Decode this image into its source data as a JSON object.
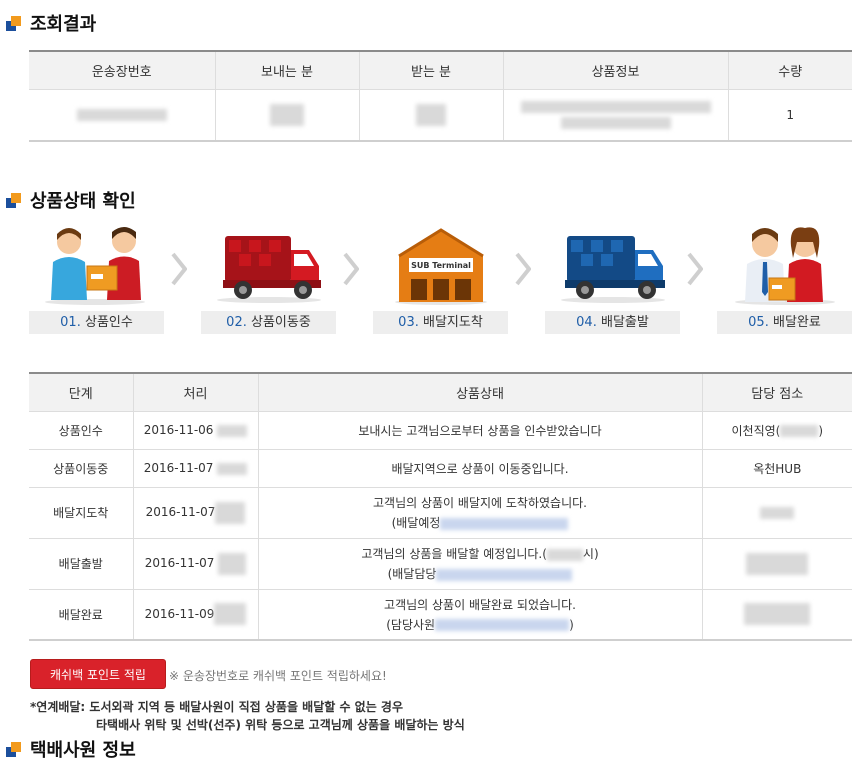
{
  "sections": {
    "result_title": "조회결과",
    "status_title": "상품상태 확인",
    "courier_title": "택배사원 정보"
  },
  "result_table": {
    "headers": [
      "운송장번호",
      "보내는 분",
      "받는 분",
      "상품정보",
      "수량"
    ],
    "quantity": "1"
  },
  "steps": [
    {
      "num": "01.",
      "label": "상품인수"
    },
    {
      "num": "02.",
      "label": "상품이동중"
    },
    {
      "num": "03.",
      "label": "배달지도착"
    },
    {
      "num": "04.",
      "label": "배달출발"
    },
    {
      "num": "05.",
      "label": "배달완료"
    }
  ],
  "terminal_sign": "SUB Terminal",
  "status_table": {
    "headers": [
      "단계",
      "처리",
      "상품상태",
      "담당 점소"
    ],
    "rows": [
      {
        "stage": "상품인수",
        "date": "2016-11-06",
        "status": "보내시는 고객님으로부터 상품을 인수받았습니다",
        "status2": "",
        "office": "이천직영("
      },
      {
        "stage": "상품이동중",
        "date": "2016-11-07",
        "status": "배달지역으로 상품이 이동중입니다.",
        "status2": "",
        "office": "옥천HUB"
      },
      {
        "stage": "배달지도착",
        "date": "2016-11-07",
        "status": "고객님의 상품이 배달지에 도착하였습니다.",
        "status2": "(배달예정",
        "office": ""
      },
      {
        "stage": "배달출발",
        "date": "2016-11-07",
        "status": "고객님의 상품을 배달할 예정입니다.(",
        "status_tail": "시)",
        "status2": "(배달담당",
        "office": ""
      },
      {
        "stage": "배달완료",
        "date": "2016-11-09",
        "status": "고객님의 상품이 배달완료 되었습니다.",
        "status2": "(담당사원",
        "status2_tail": ")",
        "office": ""
      }
    ]
  },
  "cashback": {
    "button": "캐쉬백 포인트 적립",
    "note": "※ 운송장번호로 캐쉬백 포인트 적립하세요!"
  },
  "notice": {
    "line1": "*연계배달: 도서외곽 지역 등 배달사원이 직접 상품을 배달할 수 없는 경우",
    "line2": "타택배사 위탁 및 선박(선주) 위탁 등으로 고객님께 상품을 배달하는 방식"
  },
  "colors": {
    "accent_red": "#d9222a",
    "truck_red": "#c8161d",
    "truck_blue": "#1f67b1",
    "bullet_blue": "#1c4f9c",
    "bullet_orange": "#f29a1d"
  }
}
